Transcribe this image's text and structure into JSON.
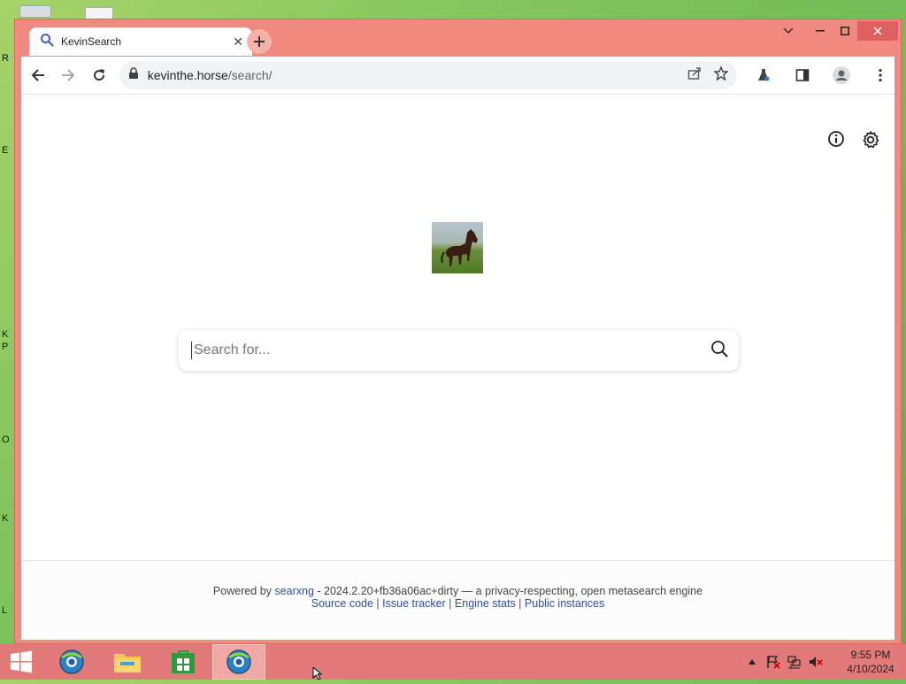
{
  "desktop": {
    "edge_letters": [
      "R",
      "E",
      "K",
      "P",
      "O",
      "K",
      "L"
    ]
  },
  "browser": {
    "tab": {
      "title": "KevinSearch"
    },
    "omnibox": {
      "host": "kevinthe.horse",
      "path": "/search/"
    }
  },
  "page": {
    "logo_alt": "horse logo",
    "search": {
      "placeholder": "Search for..."
    },
    "footer": {
      "powered_by": "Powered by",
      "engine_name": "searxng",
      "version_text": " - 2024.2.20+fb36a06ac+dirty — a privacy-respecting, open metasearch engine",
      "links": [
        "Source code",
        "Issue tracker",
        "Engine stats",
        "Public instances"
      ],
      "separator": " | "
    }
  },
  "taskbar": {
    "clock_time": "9:55 PM",
    "clock_date": "4/10/2024"
  },
  "colors": {
    "window_frame": "#f08a80",
    "taskbar": "#e17a78",
    "link": "#3050a0"
  }
}
